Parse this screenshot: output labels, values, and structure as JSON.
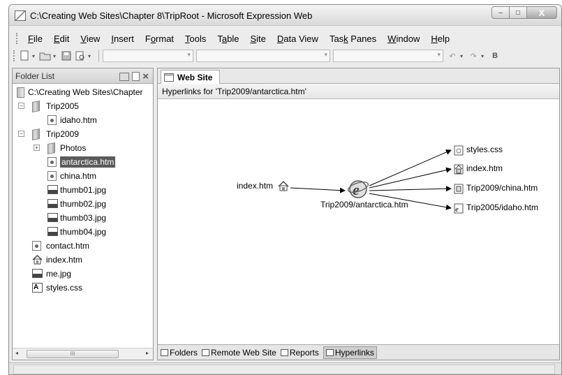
{
  "window": {
    "title": "C:\\Creating Web Sites\\Chapter 8\\TripRoot - Microsoft Expression Web",
    "buttons": {
      "minimize": "–",
      "maximize": "□",
      "close": "X"
    }
  },
  "menu": [
    {
      "label": "File",
      "accel": "F",
      "rest": "ile"
    },
    {
      "label": "Edit",
      "accel": "E",
      "rest": "dit"
    },
    {
      "label": "View",
      "accel": "V",
      "rest": "iew"
    },
    {
      "label": "Insert",
      "accel": "I",
      "rest": "nsert"
    },
    {
      "label": "Format",
      "pre": "F",
      "accel": "o",
      "rest": "rmat"
    },
    {
      "label": "Tools",
      "accel": "T",
      "rest": "ools"
    },
    {
      "label": "Table",
      "pre": "T",
      "accel": "a",
      "rest": "ble"
    },
    {
      "label": "Site",
      "accel": "S",
      "rest": "ite"
    },
    {
      "label": "Data View",
      "accel": "D",
      "rest": "ata View"
    },
    {
      "label": "Task Panes",
      "pre": "Tas",
      "accel": "k",
      "rest": " Panes"
    },
    {
      "label": "Window",
      "accel": "W",
      "rest": "indow"
    },
    {
      "label": "Help",
      "accel": "H",
      "rest": "elp"
    }
  ],
  "toolbar": {
    "bold_label": "B"
  },
  "folder_list": {
    "title": "Folder List",
    "close": "×",
    "root": "C:\\Creating Web Sites\\Chapter",
    "items": [
      {
        "label": "Trip2005",
        "type": "folder",
        "level": 1,
        "expander": "⊟"
      },
      {
        "label": "idaho.htm",
        "type": "page",
        "level": 2
      },
      {
        "label": "Trip2009",
        "type": "folder",
        "level": 1,
        "expander": "⊟"
      },
      {
        "label": "Photos",
        "type": "folder",
        "level": 2,
        "expander": "⊞"
      },
      {
        "label": "antarctica.htm",
        "type": "page",
        "level": 2,
        "selected": true
      },
      {
        "label": "china.htm",
        "type": "page",
        "level": 2
      },
      {
        "label": "thumb01.jpg",
        "type": "image",
        "level": 2
      },
      {
        "label": "thumb02.jpg",
        "type": "image",
        "level": 2
      },
      {
        "label": "thumb03.jpg",
        "type": "image",
        "level": 2
      },
      {
        "label": "thumb04.jpg",
        "type": "image",
        "level": 2
      },
      {
        "label": "contact.htm",
        "type": "page",
        "level": 1
      },
      {
        "label": "index.htm",
        "type": "home",
        "level": 1
      },
      {
        "label": "me.jpg",
        "type": "image",
        "level": 1
      },
      {
        "label": "styles.css",
        "type": "css",
        "level": 1
      }
    ],
    "scroll_left": "◂",
    "scroll_right": "▸",
    "scroll_thumb": "III"
  },
  "main": {
    "tab_label": "Web Site",
    "header": "Hyperlinks for 'Trip2009/antarctica.htm'",
    "diagram": {
      "incoming": "index.htm",
      "center": "Trip2009/antarctica.htm",
      "outgoing": [
        "styles.css",
        "index.htm",
        "Trip2009/china.htm",
        "Trip2005/idaho.htm"
      ]
    },
    "bottom_tabs": [
      {
        "label": "Folders",
        "icon": "folders-icon"
      },
      {
        "label": "Remote Web Site",
        "icon": "remote-site-icon"
      },
      {
        "label": "Reports",
        "icon": "reports-icon"
      },
      {
        "label": "Hyperlinks",
        "icon": "hyperlinks-icon",
        "active": true
      }
    ]
  }
}
